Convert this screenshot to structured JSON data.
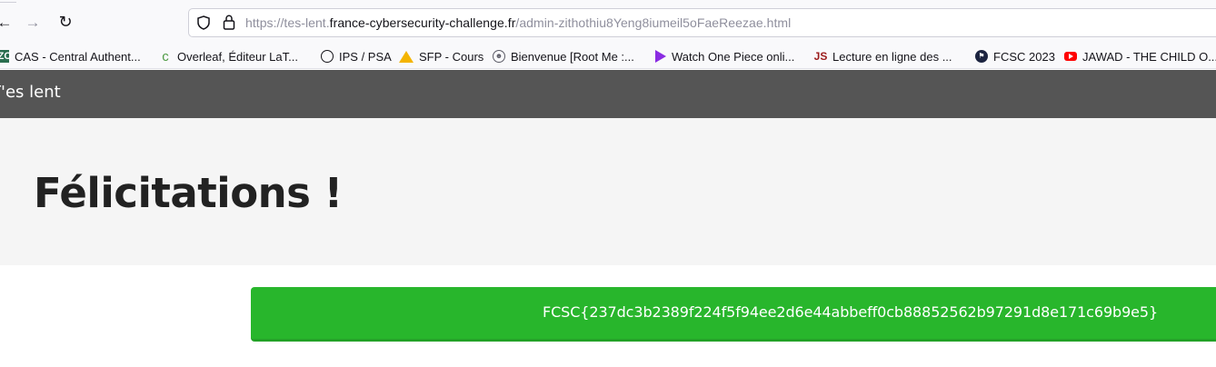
{
  "browser": {
    "url": {
      "scheme": "https://",
      "subdomain": "tes-lent.",
      "domain": "france-cybersecurity-challenge.fr",
      "path": "/admin-zithothiu8Yeng8iumeil5oFaeReezae.html"
    },
    "nav_icons": {
      "back": "arrow-left-icon",
      "forward": "arrow-right-icon",
      "reload": "reload-icon"
    }
  },
  "bookmarks": [
    {
      "label": "CAS - Central Authent...",
      "icon": "cas-favicon"
    },
    {
      "label": "Overleaf, Éditeur LaT...",
      "icon": "overleaf-favicon"
    },
    {
      "label": "IPS / PSA",
      "icon": "globe-icon"
    },
    {
      "label": "SFP - Cours",
      "icon": "google-drive-favicon"
    },
    {
      "label": "Bienvenue [Root Me :...",
      "icon": "root-me-favicon"
    },
    {
      "label": "Watch One Piece onli...",
      "icon": "play-favicon"
    },
    {
      "label": "Lecture en ligne des ...",
      "icon": "js-favicon"
    },
    {
      "label": "FCSC 2023",
      "icon": "fcsc-favicon"
    },
    {
      "label": "JAWAD - THE CHILD O...",
      "icon": "youtube-favicon"
    }
  ],
  "page": {
    "brand": "T'es lent",
    "title": "Félicitations !",
    "flag": "FCSC{237dc3b2389f224f5f94ee2d6e44abbeff0cb88852562b97291d8e171c69b9e5}"
  },
  "colors": {
    "navbar_bg": "#555555",
    "hero_bg": "#f5f5f5",
    "flag_bg": "#28b62c"
  }
}
